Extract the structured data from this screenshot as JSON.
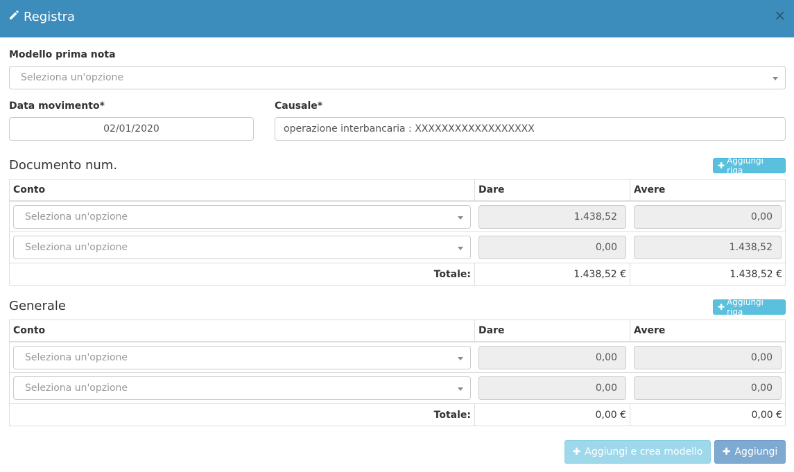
{
  "dialog": {
    "title": "Registra",
    "close_symbol": "×"
  },
  "form": {
    "modello_label": "Modello prima nota",
    "modello_placeholder": "Seleziona un'opzione",
    "data_label": "Data movimento*",
    "data_value": "02/01/2020",
    "causale_label": "Causale*",
    "causale_value": "operazione interbancaria : XXXXXXXXXXXXXXXXXX"
  },
  "documento": {
    "title": "Documento num.",
    "add_row_label": "Aggiungi riga",
    "headers": {
      "conto": "Conto",
      "dare": "Dare",
      "avere": "Avere"
    },
    "rows": [
      {
        "conto_placeholder": "Seleziona un'opzione",
        "dare": "1.438,52",
        "avere": "0,00"
      },
      {
        "conto_placeholder": "Seleziona un'opzione",
        "dare": "0,00",
        "avere": "1.438,52"
      }
    ],
    "totale_label": "Totale:",
    "totale_dare": "1.438,52 €",
    "totale_avere": "1.438,52 €"
  },
  "generale": {
    "title": "Generale",
    "add_row_label": "Aggiungi riga",
    "headers": {
      "conto": "Conto",
      "dare": "Dare",
      "avere": "Avere"
    },
    "rows": [
      {
        "conto_placeholder": "Seleziona un'opzione",
        "dare": "0,00",
        "avere": "0,00"
      },
      {
        "conto_placeholder": "Seleziona un'opzione",
        "dare": "0,00",
        "avere": "0,00"
      }
    ],
    "totale_label": "Totale:",
    "totale_dare": "0,00 €",
    "totale_avere": "0,00 €"
  },
  "footer": {
    "create_model_label": "Aggiungi e crea modello",
    "add_label": "Aggiungi"
  },
  "icons": {
    "title_icon": "pencil-icon",
    "plus_icon": "plus-icon"
  },
  "colors": {
    "header_bg": "#3c8dbc",
    "info_btn": "#5bc0de",
    "primary_btn": "#7ea9d1"
  }
}
